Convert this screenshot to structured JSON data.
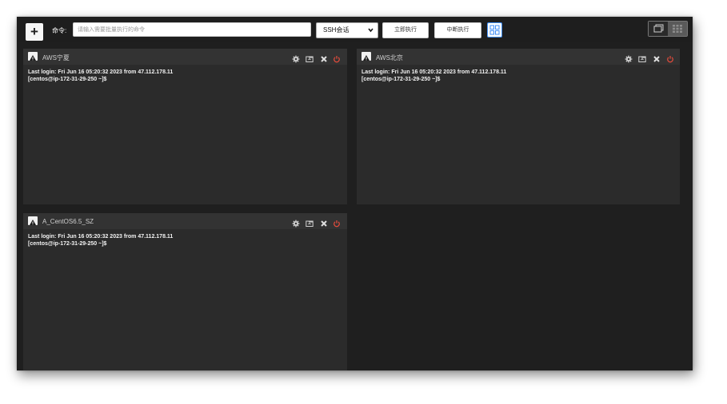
{
  "toolbar": {
    "add_icon": "plus-icon",
    "command_label": "命令:",
    "command_placeholder": "请输入需要批量执行的命令",
    "session_select": {
      "selected": "SSH会话",
      "caret": "❯"
    },
    "execute_label": "立即执行",
    "interrupt_label": "中断执行",
    "grid_icon": "grid-layout-icon",
    "layout_toggle": [
      "window-mode-icon",
      "tile-mode-icon"
    ]
  },
  "panels": [
    {
      "title": "AWS宁夏",
      "terminal": [
        "Last login: Fri Jun 16 05:20:32 2023 from 47.112.178.11",
        "[centos@ip-172-31-29-250 ~]$"
      ]
    },
    {
      "title": "AWS北京",
      "terminal": [
        "Last login: Fri Jun 16 05:20:32 2023 from 47.112.178.11",
        "[centos@ip-172-31-29-250 ~]$"
      ]
    },
    {
      "title": "A_CentOS6.5_SZ",
      "terminal": [
        "Last login: Fri Jun 16 05:20:32 2023 from 47.112.178.11",
        "[centos@ip-172-31-29-250 ~]$"
      ]
    }
  ],
  "panel_controls": [
    "gear-icon",
    "folder-icon",
    "close-icon",
    "power-icon"
  ],
  "colors": {
    "accent": "#3e8ef7",
    "power": "#e74c3c",
    "background": "#1f1f1f",
    "panel": "#2b2b2b",
    "panel_header": "#333333"
  }
}
